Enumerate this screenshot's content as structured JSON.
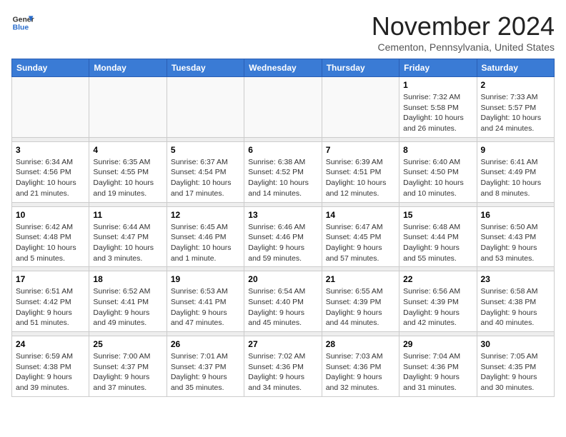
{
  "header": {
    "logo_general": "General",
    "logo_blue": "Blue",
    "month_title": "November 2024",
    "subtitle": "Cementon, Pennsylvania, United States"
  },
  "weekdays": [
    "Sunday",
    "Monday",
    "Tuesday",
    "Wednesday",
    "Thursday",
    "Friday",
    "Saturday"
  ],
  "weeks": [
    [
      {
        "day": "",
        "info": ""
      },
      {
        "day": "",
        "info": ""
      },
      {
        "day": "",
        "info": ""
      },
      {
        "day": "",
        "info": ""
      },
      {
        "day": "",
        "info": ""
      },
      {
        "day": "1",
        "info": "Sunrise: 7:32 AM\nSunset: 5:58 PM\nDaylight: 10 hours and 26 minutes."
      },
      {
        "day": "2",
        "info": "Sunrise: 7:33 AM\nSunset: 5:57 PM\nDaylight: 10 hours and 24 minutes."
      }
    ],
    [
      {
        "day": "3",
        "info": "Sunrise: 6:34 AM\nSunset: 4:56 PM\nDaylight: 10 hours and 21 minutes."
      },
      {
        "day": "4",
        "info": "Sunrise: 6:35 AM\nSunset: 4:55 PM\nDaylight: 10 hours and 19 minutes."
      },
      {
        "day": "5",
        "info": "Sunrise: 6:37 AM\nSunset: 4:54 PM\nDaylight: 10 hours and 17 minutes."
      },
      {
        "day": "6",
        "info": "Sunrise: 6:38 AM\nSunset: 4:52 PM\nDaylight: 10 hours and 14 minutes."
      },
      {
        "day": "7",
        "info": "Sunrise: 6:39 AM\nSunset: 4:51 PM\nDaylight: 10 hours and 12 minutes."
      },
      {
        "day": "8",
        "info": "Sunrise: 6:40 AM\nSunset: 4:50 PM\nDaylight: 10 hours and 10 minutes."
      },
      {
        "day": "9",
        "info": "Sunrise: 6:41 AM\nSunset: 4:49 PM\nDaylight: 10 hours and 8 minutes."
      }
    ],
    [
      {
        "day": "10",
        "info": "Sunrise: 6:42 AM\nSunset: 4:48 PM\nDaylight: 10 hours and 5 minutes."
      },
      {
        "day": "11",
        "info": "Sunrise: 6:44 AM\nSunset: 4:47 PM\nDaylight: 10 hours and 3 minutes."
      },
      {
        "day": "12",
        "info": "Sunrise: 6:45 AM\nSunset: 4:46 PM\nDaylight: 10 hours and 1 minute."
      },
      {
        "day": "13",
        "info": "Sunrise: 6:46 AM\nSunset: 4:46 PM\nDaylight: 9 hours and 59 minutes."
      },
      {
        "day": "14",
        "info": "Sunrise: 6:47 AM\nSunset: 4:45 PM\nDaylight: 9 hours and 57 minutes."
      },
      {
        "day": "15",
        "info": "Sunrise: 6:48 AM\nSunset: 4:44 PM\nDaylight: 9 hours and 55 minutes."
      },
      {
        "day": "16",
        "info": "Sunrise: 6:50 AM\nSunset: 4:43 PM\nDaylight: 9 hours and 53 minutes."
      }
    ],
    [
      {
        "day": "17",
        "info": "Sunrise: 6:51 AM\nSunset: 4:42 PM\nDaylight: 9 hours and 51 minutes."
      },
      {
        "day": "18",
        "info": "Sunrise: 6:52 AM\nSunset: 4:41 PM\nDaylight: 9 hours and 49 minutes."
      },
      {
        "day": "19",
        "info": "Sunrise: 6:53 AM\nSunset: 4:41 PM\nDaylight: 9 hours and 47 minutes."
      },
      {
        "day": "20",
        "info": "Sunrise: 6:54 AM\nSunset: 4:40 PM\nDaylight: 9 hours and 45 minutes."
      },
      {
        "day": "21",
        "info": "Sunrise: 6:55 AM\nSunset: 4:39 PM\nDaylight: 9 hours and 44 minutes."
      },
      {
        "day": "22",
        "info": "Sunrise: 6:56 AM\nSunset: 4:39 PM\nDaylight: 9 hours and 42 minutes."
      },
      {
        "day": "23",
        "info": "Sunrise: 6:58 AM\nSunset: 4:38 PM\nDaylight: 9 hours and 40 minutes."
      }
    ],
    [
      {
        "day": "24",
        "info": "Sunrise: 6:59 AM\nSunset: 4:38 PM\nDaylight: 9 hours and 39 minutes."
      },
      {
        "day": "25",
        "info": "Sunrise: 7:00 AM\nSunset: 4:37 PM\nDaylight: 9 hours and 37 minutes."
      },
      {
        "day": "26",
        "info": "Sunrise: 7:01 AM\nSunset: 4:37 PM\nDaylight: 9 hours and 35 minutes."
      },
      {
        "day": "27",
        "info": "Sunrise: 7:02 AM\nSunset: 4:36 PM\nDaylight: 9 hours and 34 minutes."
      },
      {
        "day": "28",
        "info": "Sunrise: 7:03 AM\nSunset: 4:36 PM\nDaylight: 9 hours and 32 minutes."
      },
      {
        "day": "29",
        "info": "Sunrise: 7:04 AM\nSunset: 4:36 PM\nDaylight: 9 hours and 31 minutes."
      },
      {
        "day": "30",
        "info": "Sunrise: 7:05 AM\nSunset: 4:35 PM\nDaylight: 9 hours and 30 minutes."
      }
    ]
  ]
}
